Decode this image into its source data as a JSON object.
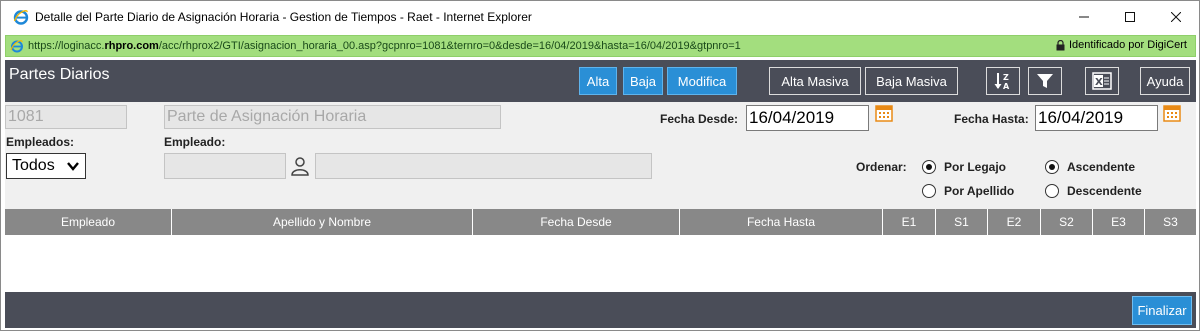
{
  "window": {
    "title": "Detalle del Parte Diario de Asignación Horaria - Gestion de Tiempos - Raet - Internet Explorer",
    "minimize": "—",
    "maximize": "☐",
    "close": "✕"
  },
  "address": {
    "url_prefix": "https://loginacc.",
    "url_domain": "rhpro.com",
    "url_rest": "/acc/rhprox2/GTI/asignacion_horaria_00.asp?gcpnro=1081&ternro=0&desde=16/04/2019&hasta=16/04/2019&gtpnro=1",
    "secure_label": "Identificado por DigiCert"
  },
  "toolbar": {
    "title": "Partes Diarios",
    "alta": "Alta",
    "baja": "Baja",
    "modifica": "Modifica",
    "alta_masiva": "Alta Masiva",
    "baja_masiva": "Baja Masiva",
    "ayuda": "Ayuda"
  },
  "form": {
    "code": "1081",
    "description": "Parte de Asignación Horaria",
    "fecha_desde_label": "Fecha Desde:",
    "fecha_desde": "16/04/2019",
    "fecha_hasta_label": "Fecha Hasta:",
    "fecha_hasta": "16/04/2019",
    "empleados_label": "Empleados:",
    "empleados_value": "Todos",
    "empleado_label": "Empleado:",
    "empleado_code": "",
    "empleado_name": "",
    "ordenar_label": "Ordenar:",
    "por_legajo": "Por Legajo",
    "por_apellido": "Por Apellido",
    "ascendente": "Ascendente",
    "descendente": "Descendente"
  },
  "table": {
    "headers": [
      "Empleado",
      "Apellido y Nombre",
      "Fecha Desde",
      "Fecha Hasta",
      "E1",
      "S1",
      "E2",
      "S2",
      "E3",
      "S3"
    ],
    "rows": []
  },
  "footer": {
    "finalizar": "Finalizar"
  },
  "colors": {
    "toolbar_bg": "#4a4d58",
    "button_blue": "#2a8fd6",
    "address_green": "#a3de7e",
    "header_gray": "#888888"
  }
}
